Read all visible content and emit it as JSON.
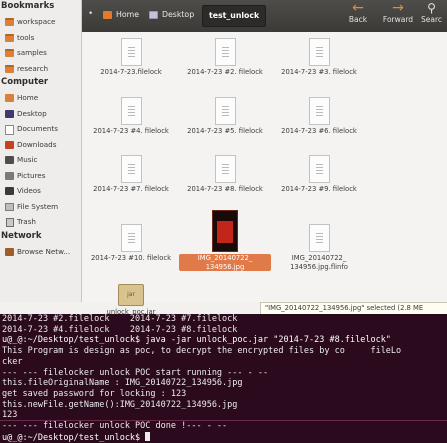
{
  "sidebar": {
    "bookmarks_header": "Bookmarks",
    "bookmarks": [
      {
        "label": "workspace",
        "icon": "folder-icon"
      },
      {
        "label": "tools",
        "icon": "folder-icon"
      },
      {
        "label": "samples",
        "icon": "folder-icon"
      },
      {
        "label": "research",
        "icon": "folder-icon"
      }
    ],
    "computer_header": "Computer",
    "computer": [
      {
        "label": "Home",
        "icon": "home-icon"
      },
      {
        "label": "Desktop",
        "icon": "desktop-icon"
      },
      {
        "label": "Documents",
        "icon": "documents-icon"
      },
      {
        "label": "Downloads",
        "icon": "downloads-icon"
      },
      {
        "label": "Music",
        "icon": "music-icon"
      },
      {
        "label": "Pictures",
        "icon": "pictures-icon"
      },
      {
        "label": "Videos",
        "icon": "videos-icon"
      },
      {
        "label": "File System",
        "icon": "filesystem-icon"
      },
      {
        "label": "Trash",
        "icon": "trash-icon"
      }
    ],
    "network_header": "Network",
    "network": [
      {
        "label": "Browse Netw...",
        "icon": "network-icon"
      }
    ]
  },
  "toolbar": {
    "breadcrumbs": [
      "Home",
      "Desktop",
      "test_unlock"
    ],
    "back_label": "Back",
    "forward_label": "Forward",
    "search_label": "Searc"
  },
  "files": [
    {
      "name": "2014-7-23.filelock"
    },
    {
      "name": "2014-7-23 #2. filelock"
    },
    {
      "name": "2014-7-23 #3. filelock"
    },
    {
      "name": "2014-7-23 #4. filelock"
    },
    {
      "name": "2014-7-23 #5. filelock"
    },
    {
      "name": "2014-7-23 #6. filelock"
    },
    {
      "name": "2014-7-23 #7. filelock"
    },
    {
      "name": "2014-7-23 #8. filelock"
    },
    {
      "name": "2014-7-23 #9. filelock"
    },
    {
      "name": "2014-7-23 #10. filelock"
    },
    {
      "name": "IMG_20140722_ 134956.jpg"
    },
    {
      "name": "IMG_20140722_ 134956.jpg.flinfo"
    },
    {
      "name": "unlock_poc.jar",
      "icon_text": "jar"
    }
  ],
  "status_bar": "\"IMG_20140722_134956.jpg\" selected (2.8 ME",
  "terminal": {
    "lines": [
      "2014-7-23 #2.filelock    2014-7-23 #7.filelock",
      "2014-7-23 #4.filelock    2014-7-23 #8.filelock",
      "u@_@:~/Desktop/test_unlock$ java -jar unlock_poc.jar \"2014-7-23 #8.filelock\"",
      "This Program is design as poc, to decrypt the encrypted files by co     fileLo",
      "cker",
      "--- --- filelocker unlock POC start running --- - --",
      "this.fileOriginalName : IMG_20140722_134956.jpg",
      "get saved password for locking : 123",
      "this.newFile.getName():IMG_20140722_134956.jpg",
      "123",
      "--- --- filelocker unlock POC done !--- - --",
      "u@_@:~/Desktop/test_unlock$ "
    ]
  }
}
